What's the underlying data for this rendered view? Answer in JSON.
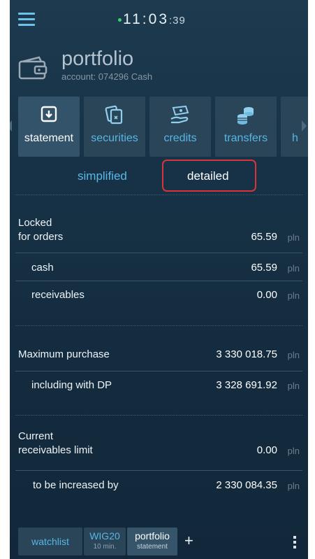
{
  "status": {
    "time_main": "11:03",
    "time_sec": ":39"
  },
  "header": {
    "title": "portfolio",
    "account": "account: 074296 Cash"
  },
  "tiles": [
    {
      "label": "statement",
      "icon": "statement-download-icon",
      "active": true
    },
    {
      "label": "securities",
      "icon": "securities-doc-icon"
    },
    {
      "label": "credits",
      "icon": "credits-hand-icon"
    },
    {
      "label": "transfers",
      "icon": "transfers-coins-icon"
    },
    {
      "label": "h"
    }
  ],
  "view_toggle": {
    "simplified": "simplified",
    "detailed": "detailed",
    "selected": "detailed"
  },
  "rows": {
    "locked": {
      "label_line1": "Locked",
      "label_line2": "for orders",
      "value": "65.59",
      "unit": "pln"
    },
    "cash": {
      "label": "cash",
      "value": "65.59",
      "unit": "pln"
    },
    "receivables": {
      "label": "receivables",
      "value": "0.00",
      "unit": "pln"
    },
    "max_purchase": {
      "label": "Maximum purchase",
      "value": "3 330 018.75",
      "unit": "pln"
    },
    "including_dp": {
      "label": "including with DP",
      "value": "3 328 691.92",
      "unit": "pln"
    },
    "current_limit": {
      "label_line1": "Current",
      "label_line2": "receivables limit",
      "value": "0.00",
      "unit": "pln"
    },
    "to_increase": {
      "label": "to be increased by",
      "value": "2 330 084.35",
      "unit": "pln"
    }
  },
  "bottom_tabs": [
    {
      "line1": "watchlist",
      "line2": ""
    },
    {
      "line1": "WIG20",
      "line2": "10 min."
    },
    {
      "line1": "portfolio",
      "line2": "statement",
      "active": true
    }
  ],
  "colors": {
    "accent": "#57b6e4",
    "background": "#173246",
    "highlight_border": "#d9333b",
    "status_dot": "#39d36b"
  }
}
